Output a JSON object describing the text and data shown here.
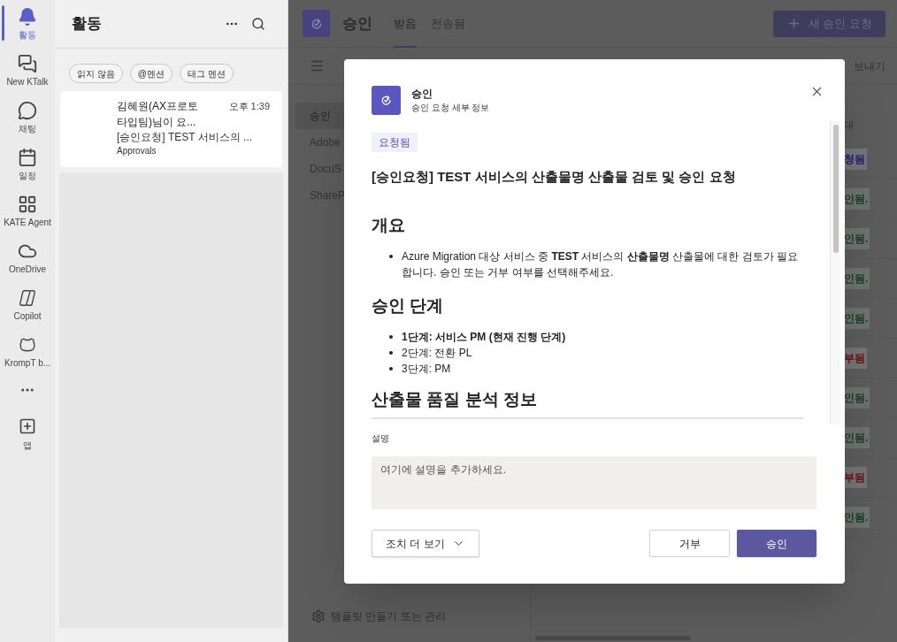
{
  "rail": {
    "items": [
      {
        "label": "활동",
        "selected": true
      },
      {
        "label": "New KTalk",
        "selected": false
      },
      {
        "label": "채팅",
        "selected": false
      },
      {
        "label": "일정",
        "selected": false
      },
      {
        "label": "KATE Agent",
        "selected": false
      },
      {
        "label": "OneDrive",
        "selected": false
      },
      {
        "label": "Copilot",
        "selected": false
      },
      {
        "label": "KrompT b...",
        "selected": false
      }
    ],
    "apps_label": "앱"
  },
  "activity": {
    "title": "활동",
    "filters": [
      "읽지 않음",
      "@멘션",
      "태그 멘션"
    ],
    "feed": [
      {
        "sender": "김혜원(AX프로토타입팀)님이 요...",
        "time": "오후 1:39",
        "preview": "[승인요청] TEST 서비스의 ...",
        "app": "Approvals"
      }
    ]
  },
  "approvals": {
    "title": "승인",
    "tabs": [
      {
        "label": "받음",
        "selected": true
      },
      {
        "label": "전송됨",
        "selected": false
      }
    ],
    "new_button": "새 승인 요청",
    "export": "보내기",
    "providers": [
      {
        "label": "승인",
        "selected": true
      },
      {
        "label": "Adobe",
        "selected": false
      },
      {
        "label": "DocuS",
        "selected": false
      },
      {
        "label": "ShareP",
        "selected": false
      }
    ],
    "template_link": "템플릿 만들기 또는 관리",
    "column_header": "대",
    "statuses": [
      {
        "text": "청됨",
        "kind": "requested"
      },
      {
        "text": "인됨.",
        "kind": "approved"
      },
      {
        "text": "인됨.",
        "kind": "approved"
      },
      {
        "text": "인됨.",
        "kind": "approved"
      },
      {
        "text": "인됨.",
        "kind": "approved"
      },
      {
        "text": "부됨",
        "kind": "rejected"
      },
      {
        "text": "인됨.",
        "kind": "approved"
      },
      {
        "text": "인됨.",
        "kind": "approved"
      },
      {
        "text": "부됨",
        "kind": "rejected"
      },
      {
        "text": "인됨.",
        "kind": "approved"
      }
    ]
  },
  "dialog": {
    "app_title": "승인",
    "subtitle": "승인 요청 세부 정보",
    "status": "요청됨",
    "title": "[승인요청] TEST 서비스의 산출물명 산출물 검토 및 승인 요청",
    "overview_heading": "개요",
    "overview": [
      "Azure Migration 대상 서비스 중 **TEST** 서비스의 **산출물명**  산출물에 대한 검토가 필요합니다. 승인 또는 거부 여부를 선택해주세요."
    ],
    "steps_heading": "승인 단계",
    "steps": [
      {
        "text": "1단계: 서비스 PM (현재 진행 단계)",
        "current": true
      },
      {
        "text": "2단계: 전환 PL",
        "current": false
      },
      {
        "text": "3단계: PM",
        "current": false
      }
    ],
    "analysis_heading": "산출물 품질 분석 정보",
    "description_label": "설명",
    "description_placeholder": "여기에 설명을 추가하세요.",
    "more_actions": "조치 더 보기",
    "reject": "거부",
    "approve": "승인"
  }
}
